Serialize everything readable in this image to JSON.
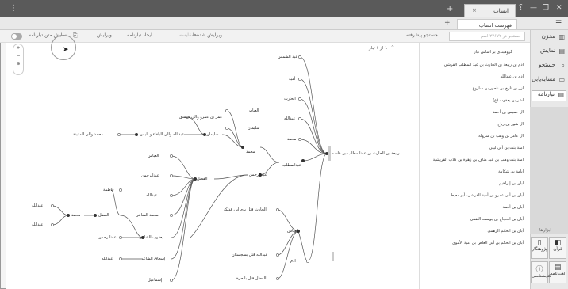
{
  "window": {
    "tab_label": "انساب",
    "tab_close": "×",
    "new_tab": "+",
    "menu": "⋮",
    "controls": [
      "—",
      "❐",
      "✕"
    ],
    "help": "؟"
  },
  "subtab": {
    "label": "فهرست انساب",
    "new": "+"
  },
  "toolbar": {
    "search_label": "جستجو پیشرفته",
    "search_placeholder": "جستجو در ۲۲۶۷۲ اسم",
    "edit_selected": "ویرایش شده‌ها",
    "compare": "مقایسه",
    "create_tree": "ایجاد تبارنامه",
    "edit": "ویرایش",
    "show_text": "نمایش متن تبارنامه",
    "pager": "۱ از ۱ تبار"
  },
  "sidebar": {
    "items": [
      {
        "label": "مخزن",
        "icon": "library-icon"
      },
      {
        "label": "نمایش",
        "icon": "display-icon"
      },
      {
        "label": "جستجو",
        "icon": "search-icon"
      },
      {
        "label": "مشابه‌یابی",
        "icon": "similar-icon"
      },
      {
        "label": "تبارنامه",
        "icon": "tree-icon"
      }
    ],
    "tools_label": "ابزارها",
    "bottom": [
      {
        "label": "قرآن",
        "icon": "quran-icon"
      },
      {
        "label": "پژوهنگار",
        "icon": "notes-icon"
      },
      {
        "label": "لغت‌نامه",
        "icon": "dictionary-icon"
      },
      {
        "label": "کتابشناسی",
        "icon": "bibliography-icon"
      }
    ]
  },
  "list": {
    "checkbox_label": "گروهبندی بر اساس تبار",
    "items": [
      "ادم بن ربیعة بن الحارث بن عبد المطلب القرشی",
      "ادم بن عبدالله",
      "آزر بن تارخ بن ناحور بن ساروغ",
      "اشر بن یعقوب (ع)",
      "ال حمیس بن أحمد",
      "ال شور بن رباح",
      "ال عامر بن وهب بن منزولة",
      "امنة بنت بن أبی لیلی",
      "امنة بنت وهب بن عبد مناف بن زهرة بن کلاب القریشیة",
      "أبامة بن شکامة",
      "أبان بن إبراهیم",
      "أبان بن أبی عمرو بن أمیة القرشی، أبو معیط",
      "أبان بن أحمد",
      "أبان بن الحجاج بن یوسف الثقفی",
      "أبان بن الحکم الزهمی",
      "أبان بن الحکم بن أبی العاص بن أمیة الأموی"
    ]
  },
  "tree": {
    "root": "ربیعة بن الحارث بن عبدالمطلب بن هاشم",
    "abd_muttalib": "عبدالمطلب",
    "muttalib_children": [
      "عبد الشمس",
      "أمیة",
      "الحارث",
      "عبدالله",
      "محمد"
    ],
    "muhammad": "محمد",
    "muhammad_children": [
      "العباس",
      "سلیمان"
    ],
    "sulayman": "سلیمان",
    "amr": "عمر بن عمرو والی دمشق",
    "abdallah_wali": "عبدالله والی البلقاء و الیمن",
    "muhammad_wali": "محمد والی المدینة",
    "fadl_root": "الفضل",
    "fadl_children": [
      "العباس",
      "عبدالرحمن",
      "عبدالله",
      "محمد الشاعر",
      "یعقوب الشاعر",
      "إسحاق الشاعر",
      "إسماعیل"
    ],
    "fadl_sub": "الفضل",
    "fadl_sub_children": [
      "فاطمة",
      "عبدالرحمن"
    ],
    "muhammad2": "محمد",
    "left_names": [
      "عبدالله",
      "عبدالله"
    ],
    "abdallah_leaf": "عبدالله",
    "abd_rahman": "عبدالرحمن",
    "abbas": "العباس",
    "abbas_children": [
      "الحارث قتل یوم أبی فدیک",
      "عبدالله قتل بسجستان",
      "الفضل قتل بالحرة"
    ],
    "adam": "ادم"
  },
  "canvas_tools": [
    "+",
    "−",
    "⊕"
  ],
  "colors": {
    "accent": "#4a4a4a",
    "line": "#555555",
    "node": "#333333"
  }
}
